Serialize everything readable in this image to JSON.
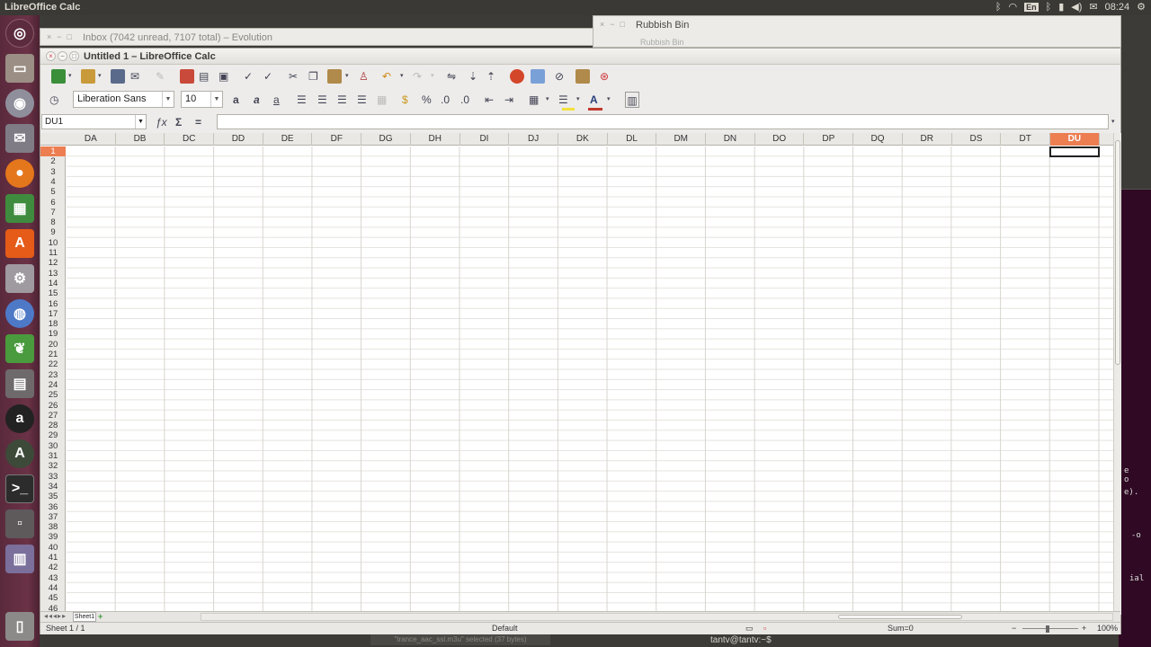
{
  "top_panel": {
    "app_title": "LibreOffice Calc",
    "keyboard_layout": "En",
    "clock": "08:24"
  },
  "background_windows": {
    "evolution_title": "Inbox (7042 unread, 7107 total) – Evolution",
    "rubbish_bin_title": "Rubbish Bin",
    "rubbish_bin_tab": "Rubbish Bin"
  },
  "window": {
    "title": "Untitled 1 – LibreOffice Calc"
  },
  "format_toolbar": {
    "font_name": "Liberation Sans",
    "font_size": "10"
  },
  "formula_bar": {
    "name_box": "DU1",
    "formula": ""
  },
  "grid": {
    "columns": [
      "DA",
      "DB",
      "DC",
      "DD",
      "DE",
      "DF",
      "DG",
      "DH",
      "DI",
      "DJ",
      "DK",
      "DL",
      "DM",
      "DN",
      "DO",
      "DP",
      "DQ",
      "DR",
      "DS",
      "DT",
      "DU"
    ],
    "selected_column": "DU",
    "rows": [
      "1",
      "2",
      "3",
      "4",
      "5",
      "6",
      "7",
      "8",
      "9",
      "10",
      "11",
      "12",
      "13",
      "14",
      "15",
      "16",
      "17",
      "18",
      "19",
      "20",
      "21",
      "22",
      "23",
      "24",
      "25",
      "26",
      "27",
      "28",
      "29",
      "30",
      "31",
      "32",
      "33",
      "34",
      "35",
      "36",
      "37",
      "38",
      "39",
      "40",
      "41",
      "42",
      "43",
      "44",
      "45",
      "46"
    ],
    "selected_row": "1"
  },
  "sheets": {
    "tab_label": "Sheet1",
    "add_label": "+"
  },
  "status_bar": {
    "sheet_pos": "Sheet 1 / 1",
    "page_style": "Default",
    "sum": "Sum=0",
    "zoom": "100%"
  },
  "taskbar": {
    "notification": "\"trance_aac_ssl.m3u\" selected (37 bytes)",
    "terminal": "tantv@tantv:~$"
  },
  "terminal_snippets": [
    "e",
    "o",
    "e).",
    "-o",
    "ial"
  ],
  "colors": {
    "selection_accent": "#ec7e52",
    "launcher_bg": "#6b3246"
  }
}
